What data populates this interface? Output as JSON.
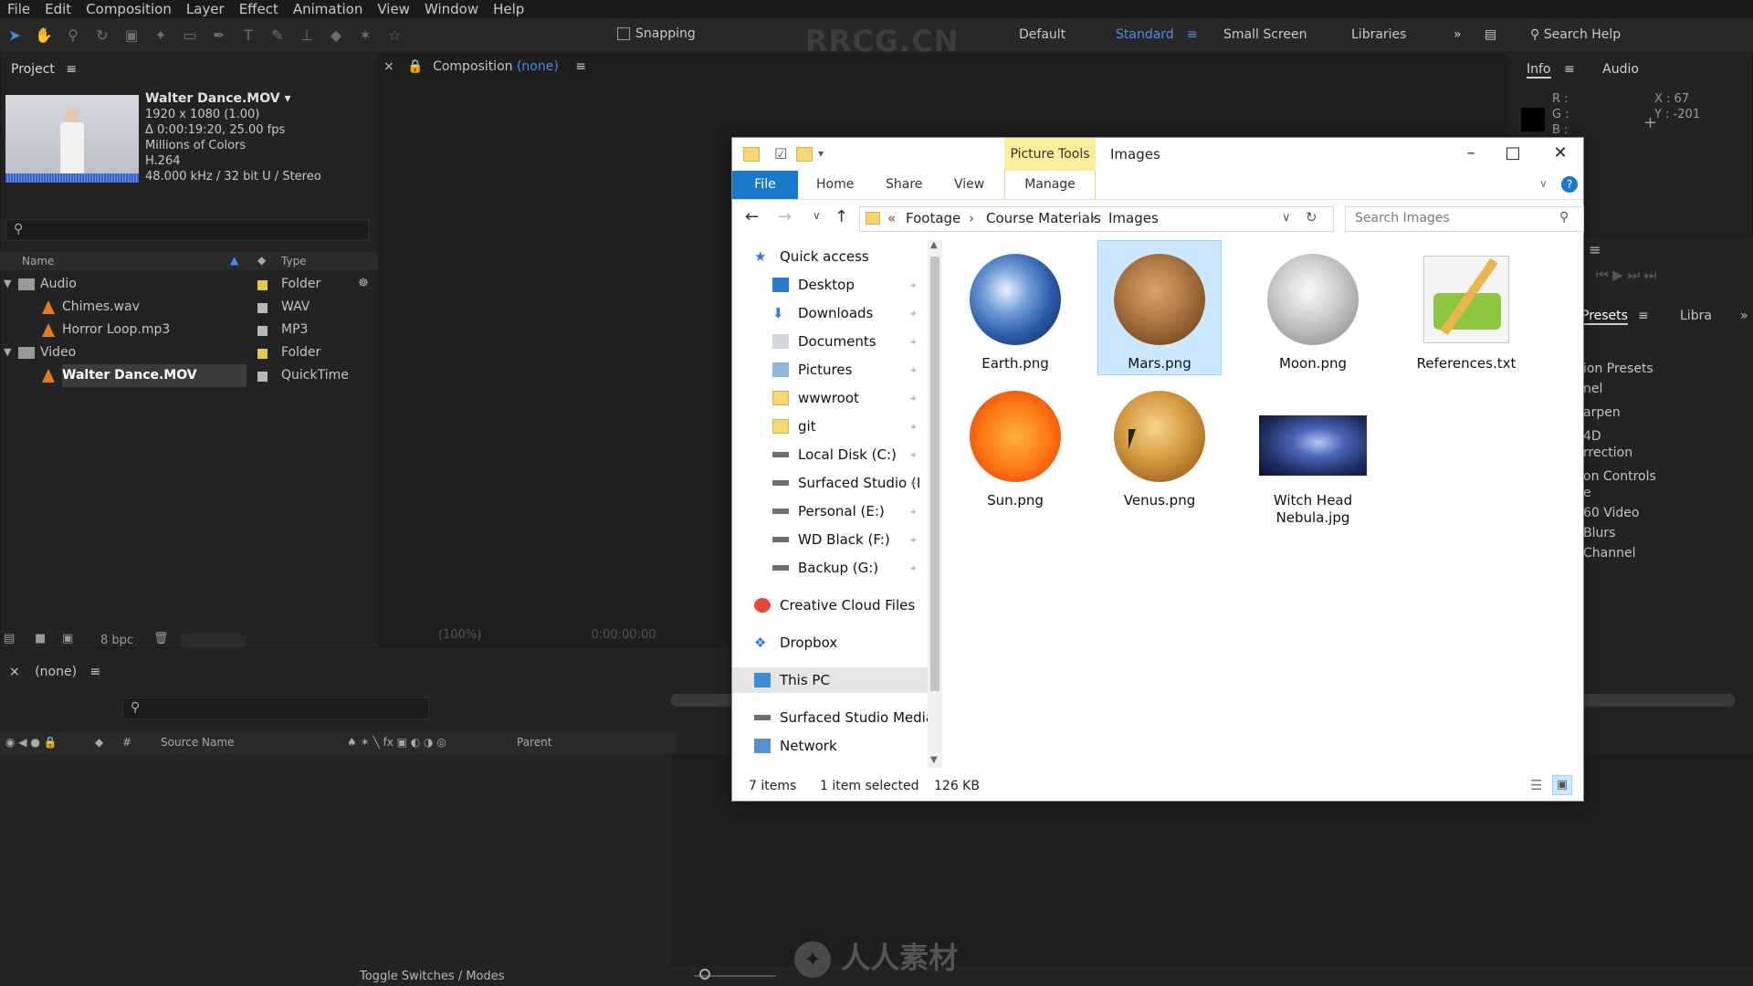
{
  "menu": [
    "File",
    "Edit",
    "Composition",
    "Layer",
    "Effect",
    "Animation",
    "View",
    "Window",
    "Help"
  ],
  "toolbar": {
    "snapping": "Snapping",
    "watermark": "RRCG.CN",
    "workspaces": [
      "Default",
      "Standard",
      "Small Screen",
      "Libraries"
    ],
    "active_workspace": "Standard",
    "search_help": "Search Help"
  },
  "project": {
    "title": "Project",
    "clip": {
      "name": "Walter Dance.MOV ▾",
      "res": "1920 x 1080 (1.00)",
      "duration": "Δ 0:00:19:20, 25.00 fps",
      "colors": "Millions of Colors",
      "codec": "H.264",
      "audio": "48.000 kHz / 32 bit U / Stereo"
    },
    "columns": {
      "name": "Name",
      "type": "Type"
    },
    "rows": [
      {
        "name": "Audio",
        "type": "Folder",
        "kind": "folder",
        "color": "#e6c84a"
      },
      {
        "name": "Chimes.wav",
        "type": "WAV",
        "kind": "file",
        "color": "#b8b8b8"
      },
      {
        "name": "Horror Loop.mp3",
        "type": "MP3",
        "kind": "file",
        "color": "#b8b8b8"
      },
      {
        "name": "Video",
        "type": "Folder",
        "kind": "folder",
        "color": "#e6c84a"
      },
      {
        "name": "Walter Dance.MOV",
        "type": "QuickTime",
        "kind": "file",
        "color": "#b8b8b8"
      }
    ],
    "bpc": "8 bpc"
  },
  "composition": {
    "label": "Composition",
    "value": "(none)",
    "zoom": "(100%)",
    "timecode": "0:00:00:00"
  },
  "info": {
    "tabs": [
      "Info",
      "Audio"
    ],
    "r": "R :",
    "g": "G :",
    "b": "B :",
    "x": "X : 67",
    "y": "Y : -201"
  },
  "effects": {
    "tabs": [
      "Presets",
      "Libra"
    ],
    "items": [
      "ion Presets",
      "nel",
      "arpen",
      "4D",
      "rrection",
      "on Controls",
      "e",
      "60 Video",
      "Blurs",
      "Channel"
    ]
  },
  "timeline": {
    "name": "(none)",
    "columns": {
      "source": "Source Name",
      "parent": "Parent"
    },
    "toggle": "Toggle Switches / Modes",
    "row_symbol": "#"
  },
  "explorer": {
    "picture_tools": "Picture Tools",
    "title": "Images",
    "tabs": [
      "File",
      "Home",
      "Share",
      "View",
      "Manage"
    ],
    "address": [
      "Footage",
      "Course Materials",
      "Images"
    ],
    "search_placeholder": "Search Images",
    "nav": [
      {
        "label": "Quick access",
        "pinned": false,
        "icon": "star"
      },
      {
        "label": "Desktop",
        "pinned": true,
        "icon": "desktop"
      },
      {
        "label": "Downloads",
        "pinned": true,
        "icon": "download"
      },
      {
        "label": "Documents",
        "pinned": true,
        "icon": "doc"
      },
      {
        "label": "Pictures",
        "pinned": true,
        "icon": "pic"
      },
      {
        "label": "wwwroot",
        "pinned": true,
        "icon": "folder"
      },
      {
        "label": "git",
        "pinned": true,
        "icon": "folder"
      },
      {
        "label": "Local Disk (C:)",
        "pinned": true,
        "icon": "drive"
      },
      {
        "label": "Surfaced Studio (I",
        "pinned": true,
        "icon": "drive"
      },
      {
        "label": "Personal (E:)",
        "pinned": true,
        "icon": "drive"
      },
      {
        "label": "WD Black (F:)",
        "pinned": true,
        "icon": "drive"
      },
      {
        "label": "Backup (G:)",
        "pinned": true,
        "icon": "drive"
      },
      {
        "label": "Creative Cloud Files",
        "pinned": false,
        "icon": "cc"
      },
      {
        "label": "Dropbox",
        "pinned": false,
        "icon": "dropbox"
      },
      {
        "label": "This PC",
        "pinned": false,
        "icon": "pc"
      },
      {
        "label": "Surfaced Studio Media",
        "pinned": false,
        "icon": "drive"
      },
      {
        "label": "Network",
        "pinned": false,
        "icon": "net"
      }
    ],
    "items": [
      {
        "name": "Earth.png",
        "kind": "earth"
      },
      {
        "name": "Mars.png",
        "kind": "mars",
        "selected": true
      },
      {
        "name": "Moon.png",
        "kind": "moon"
      },
      {
        "name": "References.txt",
        "kind": "notepad"
      },
      {
        "name": "Sun.png",
        "kind": "sun"
      },
      {
        "name": "Venus.png",
        "kind": "venus"
      },
      {
        "name": "Witch Head Nebula.jpg",
        "kind": "nebula"
      }
    ],
    "status": {
      "count": "7 items",
      "selected": "1 item selected",
      "size": "126 KB"
    }
  },
  "watermark_bottom": "人人素材"
}
